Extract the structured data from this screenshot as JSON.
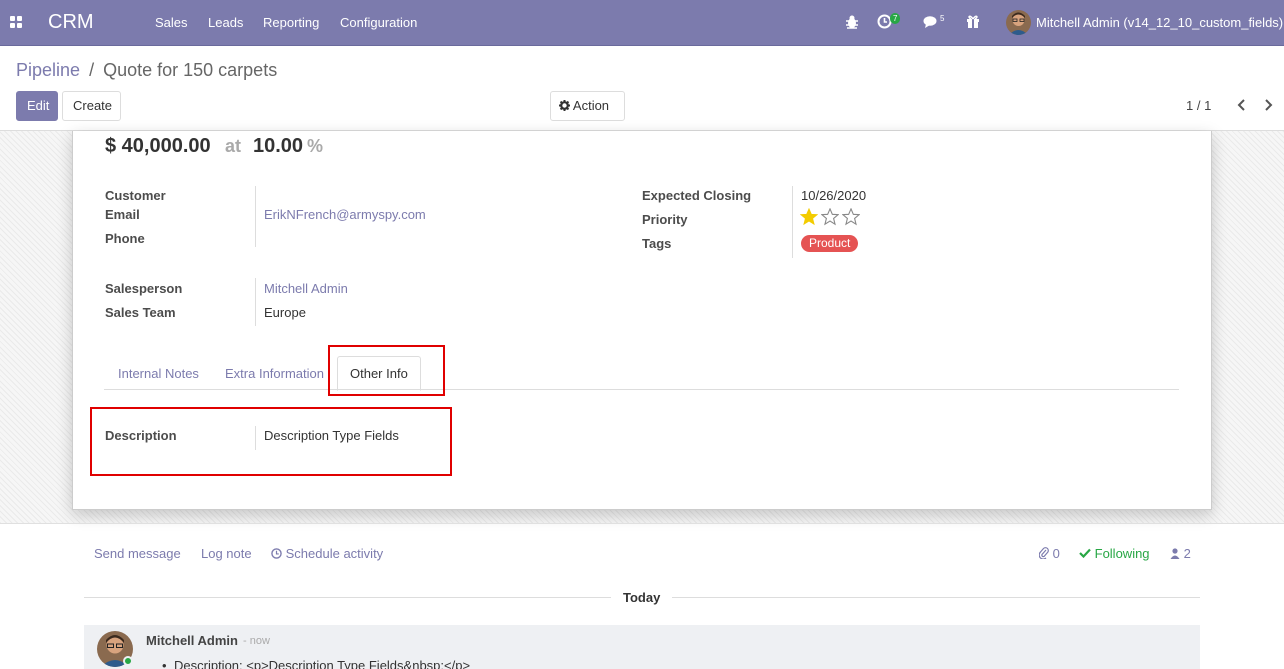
{
  "navbar": {
    "app_title": "CRM",
    "menu": [
      "Sales",
      "Leads",
      "Reporting",
      "Configuration"
    ],
    "activity_count": "7",
    "message_count": "5",
    "user": "Mitchell Admin (v14_12_10_custom_fields)",
    "accent_color": "#7c7bad"
  },
  "control_panel": {
    "breadcrumb_parent": "Pipeline",
    "breadcrumb_sep": "/",
    "breadcrumb_current": "Quote for 150 carpets",
    "edit_label": "Edit",
    "create_label": "Create",
    "action_label": "Action",
    "pager": "1 / 1"
  },
  "record": {
    "revenue": "$ 40,000.00",
    "at": "at",
    "probability": "10.00",
    "percent": "%",
    "labels": {
      "customer": "Customer",
      "email": "Email",
      "phone": "Phone",
      "salesperson": "Salesperson",
      "sales_team": "Sales Team",
      "expected_closing": "Expected Closing",
      "priority": "Priority",
      "tags": "Tags",
      "description": "Description"
    },
    "email": "ErikNFrench@armyspy.com",
    "salesperson": "Mitchell Admin",
    "sales_team": "Europe",
    "expected_closing": "10/26/2020",
    "priority_stars": 1,
    "priority_max": 3,
    "tag": "Product",
    "description": "Description Type Fields"
  },
  "tabs": [
    "Internal Notes",
    "Extra Information",
    "Other Info"
  ],
  "active_tab": "Other Info",
  "chatter": {
    "send_message": "Send message",
    "log_note": "Log note",
    "schedule_activity": "Schedule activity",
    "attachments": "0",
    "following": "Following",
    "followers": "2",
    "today": "Today",
    "author": "Mitchell Admin",
    "time": "- now",
    "tracking": "Description: <p>Description Type Fields&nbsp;</p>"
  }
}
